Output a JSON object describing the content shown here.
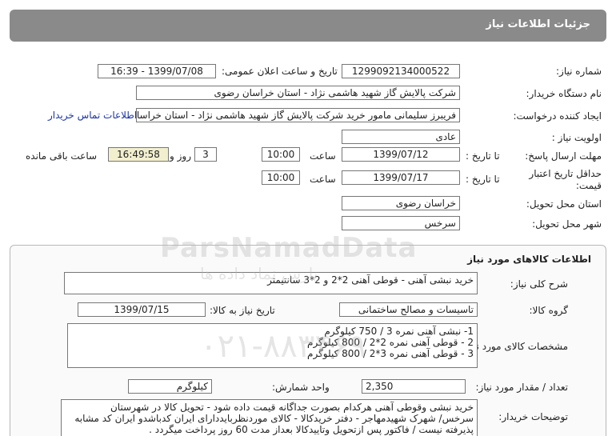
{
  "header": {
    "title": "جزئیات اطلاعات نیاز"
  },
  "fields": {
    "need_number_label": "شماره نیاز:",
    "need_number": "1299092134000522",
    "announce_label": "تاریخ و ساعت اعلان عمومی:",
    "announce_value": "1399/07/08 - 16:39",
    "buyer_label": "نام دستگاه خریدار:",
    "buyer_value": "شرکت پالایش گاز شهید هاشمی نژاد - استان خراسان رضوی",
    "creator_label": "ایجاد کننده درخواست:",
    "creator_value": "فریبرز  سلیمانی مامور خرید شرکت پالایش گاز شهید هاشمی نژاد - استان خراسان رضوی",
    "contact_link": "اطلاعات تماس خریدار",
    "priority_label": "اولویت نیاز :",
    "priority_value": "عادی",
    "deadline_label": "مهلت ارسال پاسخ:",
    "to_date_label": "تا تاریخ :",
    "deadline_date": "1399/07/12",
    "time_label": "ساعت",
    "deadline_time": "10:00",
    "days_value": "3",
    "days_label": "روز و",
    "remaining_time": "16:49:58",
    "remaining_label": "ساعت باقی مانده",
    "validity_label_1": "حداقل تاریخ اعتبار",
    "validity_label_2": "قیمت:",
    "validity_to_label": "تا تاریخ :",
    "validity_date": "1399/07/17",
    "validity_time_label": "ساعت",
    "validity_time": "10:00",
    "province_label": "استان محل تحویل:",
    "province_value": "خراسان رضوی",
    "city_label": "شهر محل تحویل:",
    "city_value": "سرخس"
  },
  "goods": {
    "section_title": "اطلاعات کالاهای مورد نیاز",
    "summary_label": "شرح کلی نیاز:",
    "summary_value": "خرید نبشی آهنی - قوطی آهنی  2*2 و 2*3  سانتیمتر",
    "group_label": "گروه کالا:",
    "group_value": "تاسیسات و مصالح ساختمانی",
    "need_date_label": "تاریخ نیاز به کالا:",
    "need_date": "1399/07/15",
    "specs_label": "مشخصات کالای مورد نیاز:",
    "specs": [
      "1- نبشی آهنی نمره 3  /  750  کیلوگرم",
      "2 - قوطی آهنی نمره 2*2 / 800  کیلوگرم",
      "3 - قوطی آهنی نمره 3*2 / 800  کیلوگرم"
    ],
    "qty_label": "تعداد / مقدار مورد نیاز:",
    "qty_value": "2,350",
    "unit_label": "واحد شمارش:",
    "unit_value": "کیلوگرم",
    "desc_label": "توضیحات خریدار:",
    "desc_lines": [
      "خرید نبشی وقوطی آهنی هرکدام بصورت جداگانه قیمت داده شود -  تحویل کالا در شهرستان",
      "سرخس/ شهرک شهیدمهاجر - دفتر خریدکالا - کالای موردنظربایددارای ایران کدباشدو ایران کد مشابه",
      "پذیرفته نیست / فاکتور پس ازتحویل وتاییدکالا بعداز مدت 60 روز پرداخت میگردد ."
    ]
  },
  "watermark": {
    "brand": "ParsNamadData",
    "tagline": "پارس نماد داده ها",
    "phone": "۰۲۱-۸۸۳۴۶۹"
  }
}
